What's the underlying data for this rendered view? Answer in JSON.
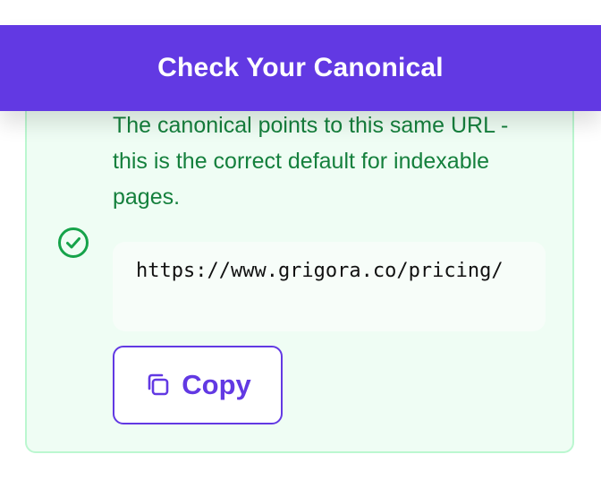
{
  "header": {
    "title": "Check Your Canonical"
  },
  "result": {
    "status": "success",
    "status_icon": "check-circle-icon",
    "message": "The canonical points to this same URL - this is the correct default for indexable pages.",
    "url": "https://www.grigora.co/pricing/"
  },
  "copy_button": {
    "label": "Copy",
    "icon": "copy-icon"
  },
  "colors": {
    "brand": "#6239e3",
    "success_text": "#15803d",
    "success_icon": "#16a34a",
    "card_background": "#effdf4",
    "card_border": "#bbf7d0"
  }
}
